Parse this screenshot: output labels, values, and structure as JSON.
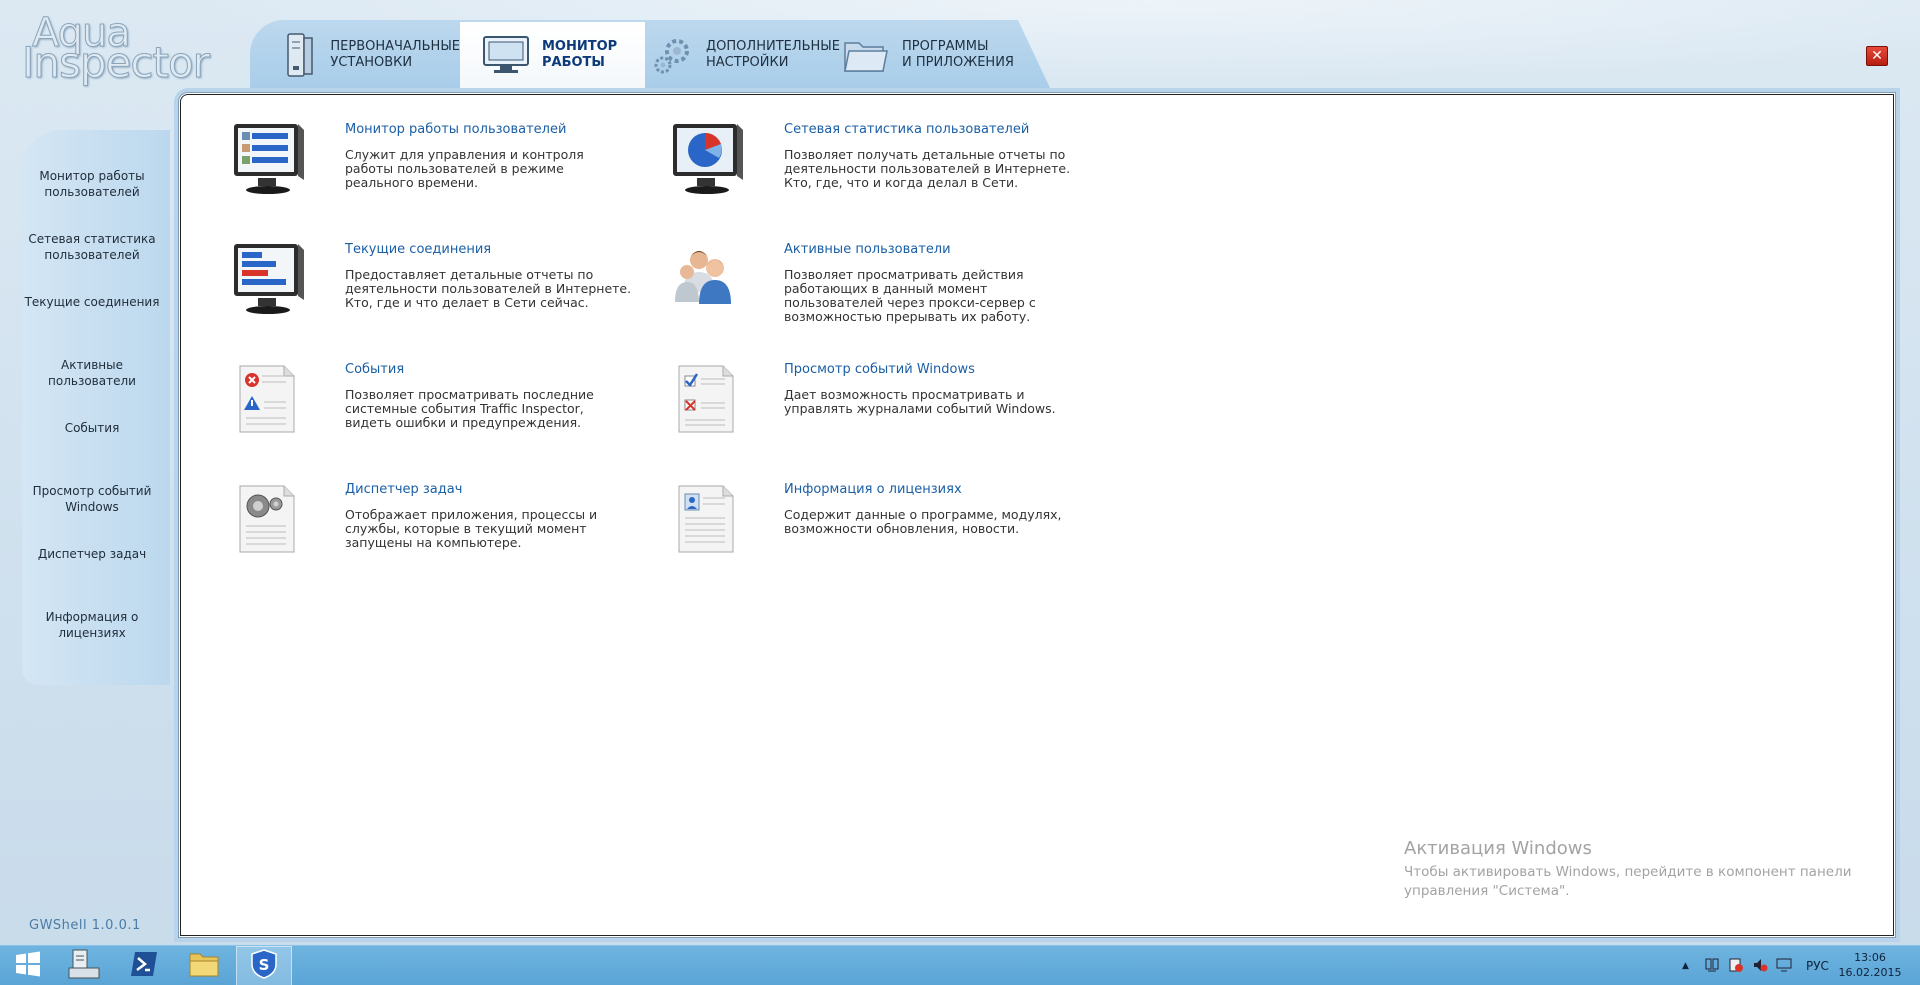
{
  "app": {
    "logo_line1": "Aqua",
    "logo_line2": "Inspector",
    "version": "GWShell   1.0.0.1"
  },
  "tabs": [
    {
      "label": "ПЕРВОНАЧАЛЬНЫЕ\nУСТАНОВКИ",
      "icon": "server-icon"
    },
    {
      "label": "МОНИТОР\nРАБОТЫ",
      "icon": "monitor-icon",
      "active": true
    },
    {
      "label": "ДОПОЛНИТЕЛЬНЫЕ\nНАСТРОЙКИ",
      "icon": "gears-icon"
    },
    {
      "label": "ПРОГРАММЫ\nИ ПРИЛОЖЕНИЯ",
      "icon": "folder-icon"
    }
  ],
  "close_label": "✕",
  "sidebar": {
    "items": [
      {
        "label": "Монитор работы\nпользователей"
      },
      {
        "label": "Сетевая статистика\nпользователей"
      },
      {
        "label": "Текущие соединения"
      },
      {
        "label": "Активные\nпользователи"
      },
      {
        "label": "События"
      },
      {
        "label": "Просмотр событий\nWindows"
      },
      {
        "label": "Диспетчер задач"
      },
      {
        "label": "Информация о\nлицензиях"
      }
    ]
  },
  "items": [
    {
      "title": "Монитор работы пользователей",
      "desc": "Служит для управления и контроля\nработы пользователей в режиме\nреального времени.",
      "icon": "monitor-users-icon"
    },
    {
      "title": "Сетевая статистика пользователей",
      "desc": "Позволяет получать детальные отчеты по\nдеятельности пользователей в Интернете.\nКто, где, что и когда делал в Сети.",
      "icon": "pie-chart-monitor-icon"
    },
    {
      "title": "Текущие соединения",
      "desc": "Предоставляет детальные отчеты по\nдеятельности пользователей в Интернете.\nКто, где и что делает в Сети сейчас.",
      "icon": "connections-monitor-icon"
    },
    {
      "title": "Активные пользователи",
      "desc": "Позволяет просматривать действия\nработающих в данный момент\nпользователей через прокси-сервер с\nвозможностью прерывать их работу.",
      "icon": "users-icon"
    },
    {
      "title": "События",
      "desc": "Позволяет просматривать последние\nсистемные события Traffic Inspector,\nвидеть ошибки и предупреждения.",
      "icon": "events-document-icon"
    },
    {
      "title": "Просмотр событий Windows",
      "desc": "Дает возможность просматривать и\nуправлять журналами событий Windows.",
      "icon": "checklist-document-icon"
    },
    {
      "title": "Диспетчер задач",
      "desc": "Отображает приложения, процессы и\nслужбы, которые в текущий момент\nзапущены на компьютере.",
      "icon": "task-manager-document-icon"
    },
    {
      "title": "Информация о лицензиях",
      "desc": "Содержит данные о программе, модулях,\nвозможности обновления, новости.",
      "icon": "license-document-icon"
    }
  ],
  "activation": {
    "title": "Активация Windows",
    "text": "Чтобы активировать Windows, перейдите в компонент панели\nуправления \"Система\"."
  },
  "taskbar": {
    "tray_language": "РУС",
    "time": "13:06",
    "date": "16.02.2015",
    "tray_arrow": "▲"
  }
}
